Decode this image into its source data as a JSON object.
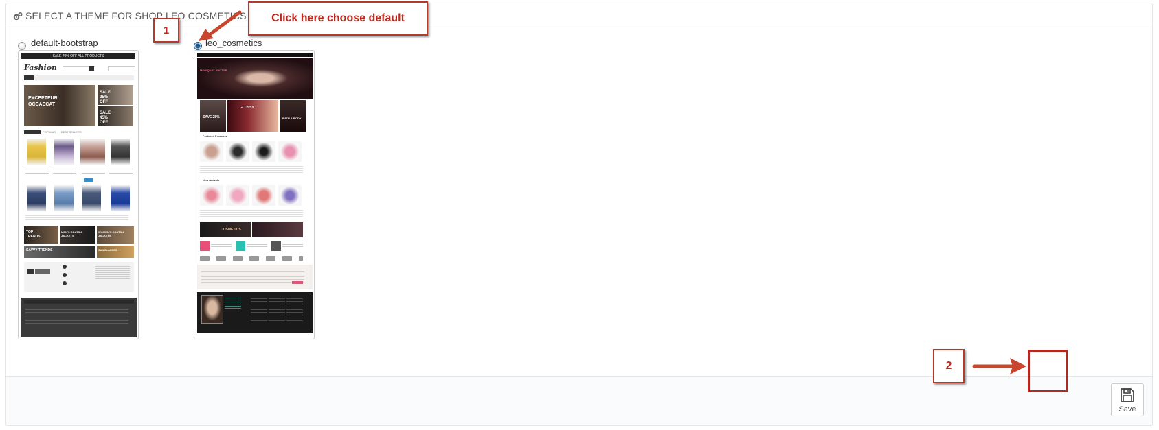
{
  "header": {
    "title": "SELECT A THEME FOR SHOP LEO COSMETICS",
    "icon": "cogs-icon"
  },
  "themes": [
    {
      "name": "default-bootstrap",
      "selected": false,
      "preview": {
        "promo": "SALE 70% OFF ALL PRODUCTS",
        "logo": "Fashion",
        "menu": [
          "WOMEN",
          "DRESSES",
          "T-SHIRTS",
          "BLOG"
        ],
        "hero": [
          "EXCEPTEUR",
          "OCCAECAT"
        ],
        "side_banners": [
          "SALE 25% OFF",
          "SALE 45% OFF"
        ],
        "tabs": [
          "POPULAR",
          "BEST SELLERS"
        ],
        "promo_banners": [
          "TOP TRENDS",
          "MEN'S COATS & JACKETS",
          "WOMEN'S COATS & JACKETS",
          "SAVVY TRENDS",
          "SUNGLASSES"
        ]
      }
    },
    {
      "name": "leo_cosmetics",
      "selected": true,
      "preview": {
        "hero": "MONIQUAT AUCTOR",
        "banners": [
          "SAVE 25%",
          "GLOSSY",
          "BATH & BODY"
        ],
        "sections": [
          "Featured Products",
          "New Arrivals"
        ],
        "promo_banner": "COSMETICS"
      }
    }
  ],
  "footer": {
    "save_label": "Save",
    "save_icon": "floppy-disk-icon"
  },
  "annotations": {
    "callout_main": "Click here choose default",
    "callout_step1": "1",
    "callout_step2": "2",
    "color": "#c0271d"
  }
}
